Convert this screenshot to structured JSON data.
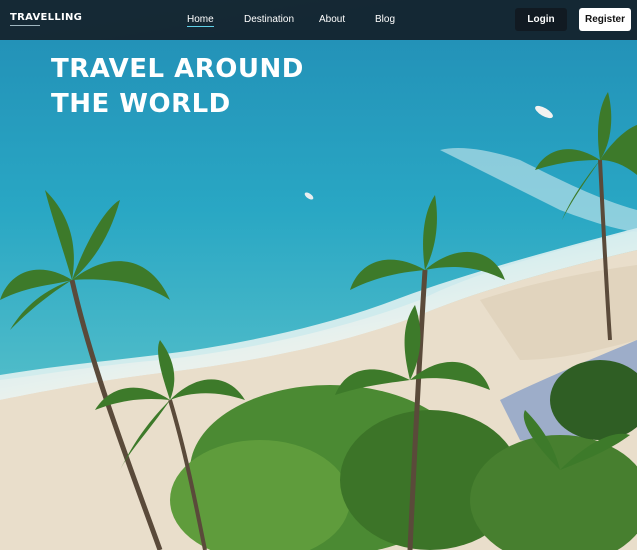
{
  "nav": {
    "brand": "TRAVELLING",
    "links": [
      {
        "label": "Home",
        "active": true
      },
      {
        "label": "Destination",
        "active": false
      },
      {
        "label": "About",
        "active": false
      },
      {
        "label": "Blog",
        "active": false
      }
    ],
    "login_label": "Login",
    "register_label": "Register"
  },
  "hero": {
    "headline_line1": "TRAVEL AROUND",
    "headline_line2": "THE WORLD"
  },
  "colors": {
    "nav_bg": "#141e28",
    "accent": "#5fd0e6",
    "ocean": "#1b94bb",
    "sand": "#ece2d0",
    "foliage": "#3f7d2c"
  }
}
